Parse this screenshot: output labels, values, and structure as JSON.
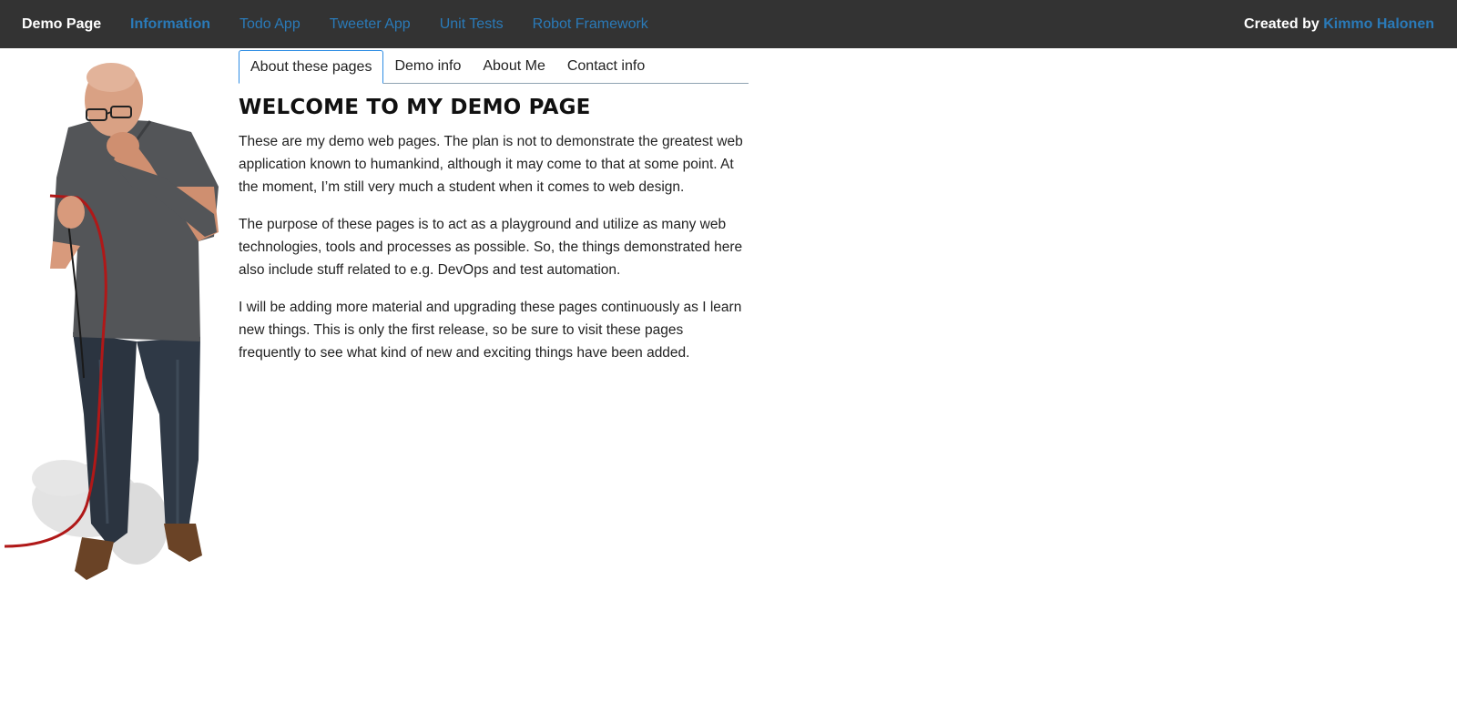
{
  "navbar": {
    "brand": "Demo Page",
    "links": [
      {
        "label": "Information",
        "active": true
      },
      {
        "label": "Todo App",
        "active": false
      },
      {
        "label": "Tweeter App",
        "active": false
      },
      {
        "label": "Unit Tests",
        "active": false
      },
      {
        "label": "Robot Framework",
        "active": false
      }
    ],
    "created_prefix": "Created by",
    "created_author": "Kimmo Halonen"
  },
  "tabs": [
    {
      "label": "About these pages",
      "active": true
    },
    {
      "label": "Demo info",
      "active": false
    },
    {
      "label": "About Me",
      "active": false
    },
    {
      "label": "Contact info",
      "active": false
    }
  ],
  "main": {
    "heading": "WELCOME TO MY DEMO PAGE",
    "paragraphs": [
      "These are my demo web pages. The plan is not to demonstrate the greatest web application known to humankind, although it may come to that at some point. At the moment, I’m still very much a student when it comes to web design.",
      "The purpose of these pages is to act as a playground and utilize as many web technologies, tools and processes as possible. So, the things demonstrated here also include stuff related to e.g. DevOps and test automation.",
      "I will be adding more material and upgrading these pages continuously as I learn new things. This is only the first release, so be sure to visit these pages frequently to see what kind of new and exciting things have been added."
    ]
  },
  "colors": {
    "navbar_bg": "#333333",
    "link": "#2a7ab8",
    "tab_active_border": "#2f8de4"
  }
}
